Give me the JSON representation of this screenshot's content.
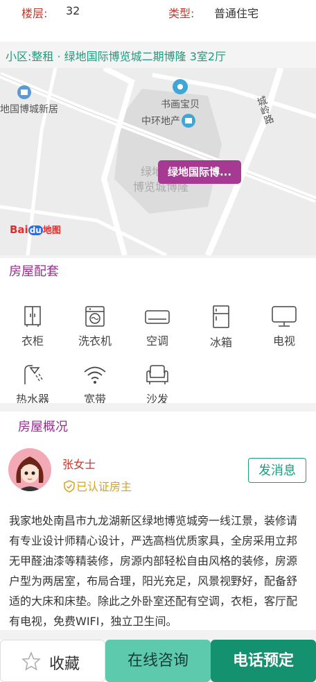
{
  "info": {
    "floor_label": "楼层:",
    "floor_value": "32",
    "type_label": "类型:",
    "type_value": "普通住宅"
  },
  "community": {
    "text": "小区:整租 · 绿地国际博览城二期博隆 3室2厅"
  },
  "map": {
    "labels": {
      "poi_left": "地国博城新居",
      "poi_shuhua": "书画宝贝",
      "poi_zhonghuan": "中环地产",
      "road": "城岭路",
      "area_line1": "绿地",
      "area_line2": "博览城博隆"
    },
    "bubble": "绿地国际博...",
    "logo_bai": "Bai",
    "logo_du": "du",
    "logo_map": "地图"
  },
  "amenities": {
    "title": "房屋配套",
    "items": [
      {
        "label": "衣柜",
        "icon": "wardrobe-icon"
      },
      {
        "label": "洗衣机",
        "icon": "washing-machine-icon"
      },
      {
        "label": "空调",
        "icon": "air-conditioner-icon"
      },
      {
        "label": "冰箱",
        "icon": "fridge-icon"
      },
      {
        "label": "电视",
        "icon": "tv-icon"
      },
      {
        "label": "热水器",
        "icon": "water-heater-icon"
      },
      {
        "label": "宽带",
        "icon": "wifi-icon"
      },
      {
        "label": "沙发",
        "icon": "sofa-icon"
      }
    ]
  },
  "overview": {
    "title": "房屋概况",
    "landlord_name": "张女士",
    "verified_label": "已认证房主",
    "message_button": "发消息",
    "description": "我家地处南昌市九龙湖新区绿地博览城旁一线江景，装修请有专业设计师精心设计，严选高档优质家具，全房采用立邦无甲醛油漆等精装修，房源内部轻松自由风格的装修，房源户型为两居室，布局合理，阳光充足，风景视野好，配备舒适的大床和床垫。除此之外卧室还配有空调，衣柜，客厅配有电视，免费WIFI，独立卫生间。"
  },
  "bottom_bar": {
    "favorite": "收藏",
    "chat": "在线咨询",
    "call": "电话预定"
  },
  "colors": {
    "accent_green": "#14926f",
    "light_green": "#5dc9ad",
    "purple": "#a63a93",
    "label_red": "#c0392b"
  }
}
